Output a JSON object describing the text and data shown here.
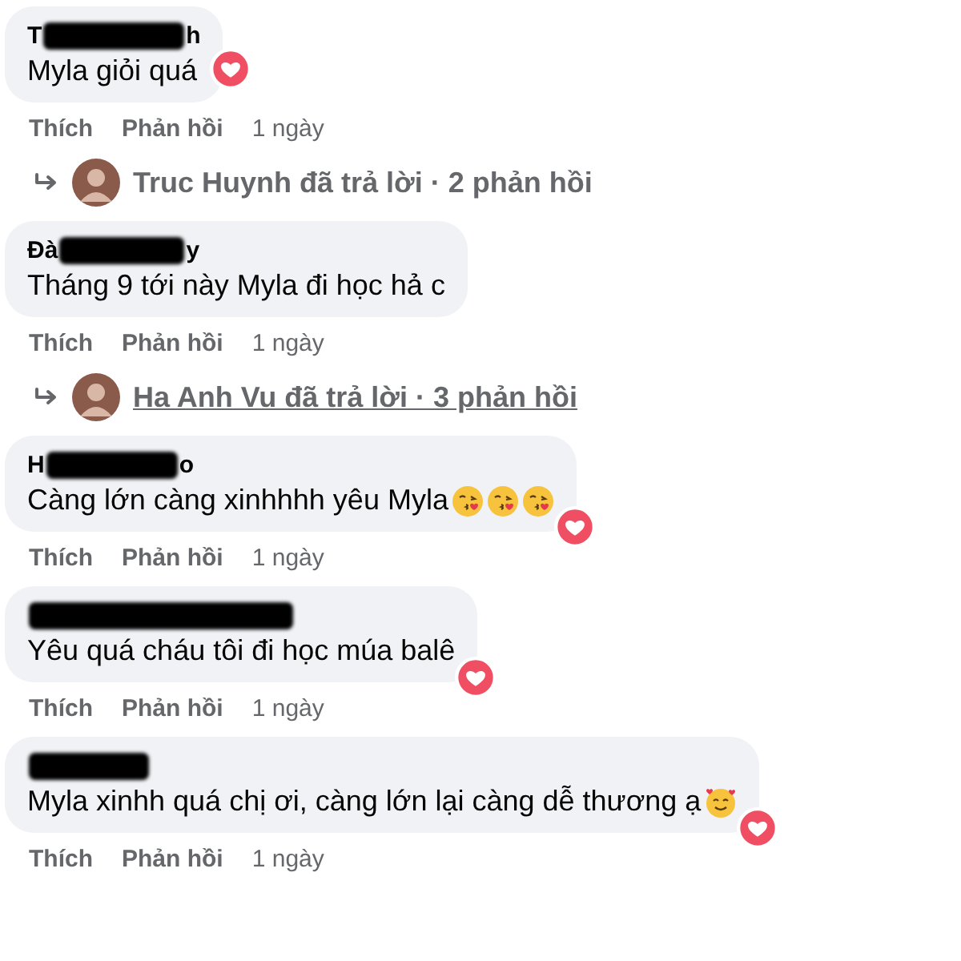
{
  "comments": [
    {
      "name": {
        "start": "T",
        "end": "h"
      },
      "text": "Myla giỏi quá",
      "reaction": {
        "kind": "love"
      },
      "actions": [
        "Thích",
        "Phản hồi",
        "1 ngày"
      ],
      "replies": {
        "text": "Truc Huynh đã trả lời · 2 phản hồi",
        "underlined": false
      }
    },
    {
      "name": {
        "start": "Đà",
        "end": "y"
      },
      "text": "Tháng 9 tới này Myla đi học hả c",
      "actions": [
        "Thích",
        "Phản hồi",
        "1 ngày"
      ],
      "replies": {
        "text": "Ha Anh Vu đã trả lời · 3 phản hồi",
        "underlined": true
      }
    },
    {
      "name": {
        "start": "H",
        "end": "o"
      },
      "text": "Càng lớn càng xinhhhh yêu Myla",
      "emojis": [
        {
          "kind": "kiss"
        },
        {
          "kind": "kiss"
        },
        {
          "kind": "kiss"
        }
      ],
      "reaction": {
        "kind": "love"
      },
      "actions": [
        "Thích",
        "Phản hồi",
        "1 ngày"
      ]
    },
    {
      "text": "Yêu quá cháu tôi đi học múa balê",
      "reaction": {
        "kind": "love"
      },
      "actions": [
        "Thích",
        "Phản hồi",
        "1 ngày"
      ]
    },
    {
      "text": "Myla xinhh quá chị ơi, càng lớn lại càng dễ thương ạ",
      "emojis": [
        {
          "kind": "hearts"
        }
      ],
      "reaction": {
        "kind": "love"
      },
      "actions": [
        "Thích",
        "Phản hồi",
        "1 ngày"
      ]
    }
  ]
}
